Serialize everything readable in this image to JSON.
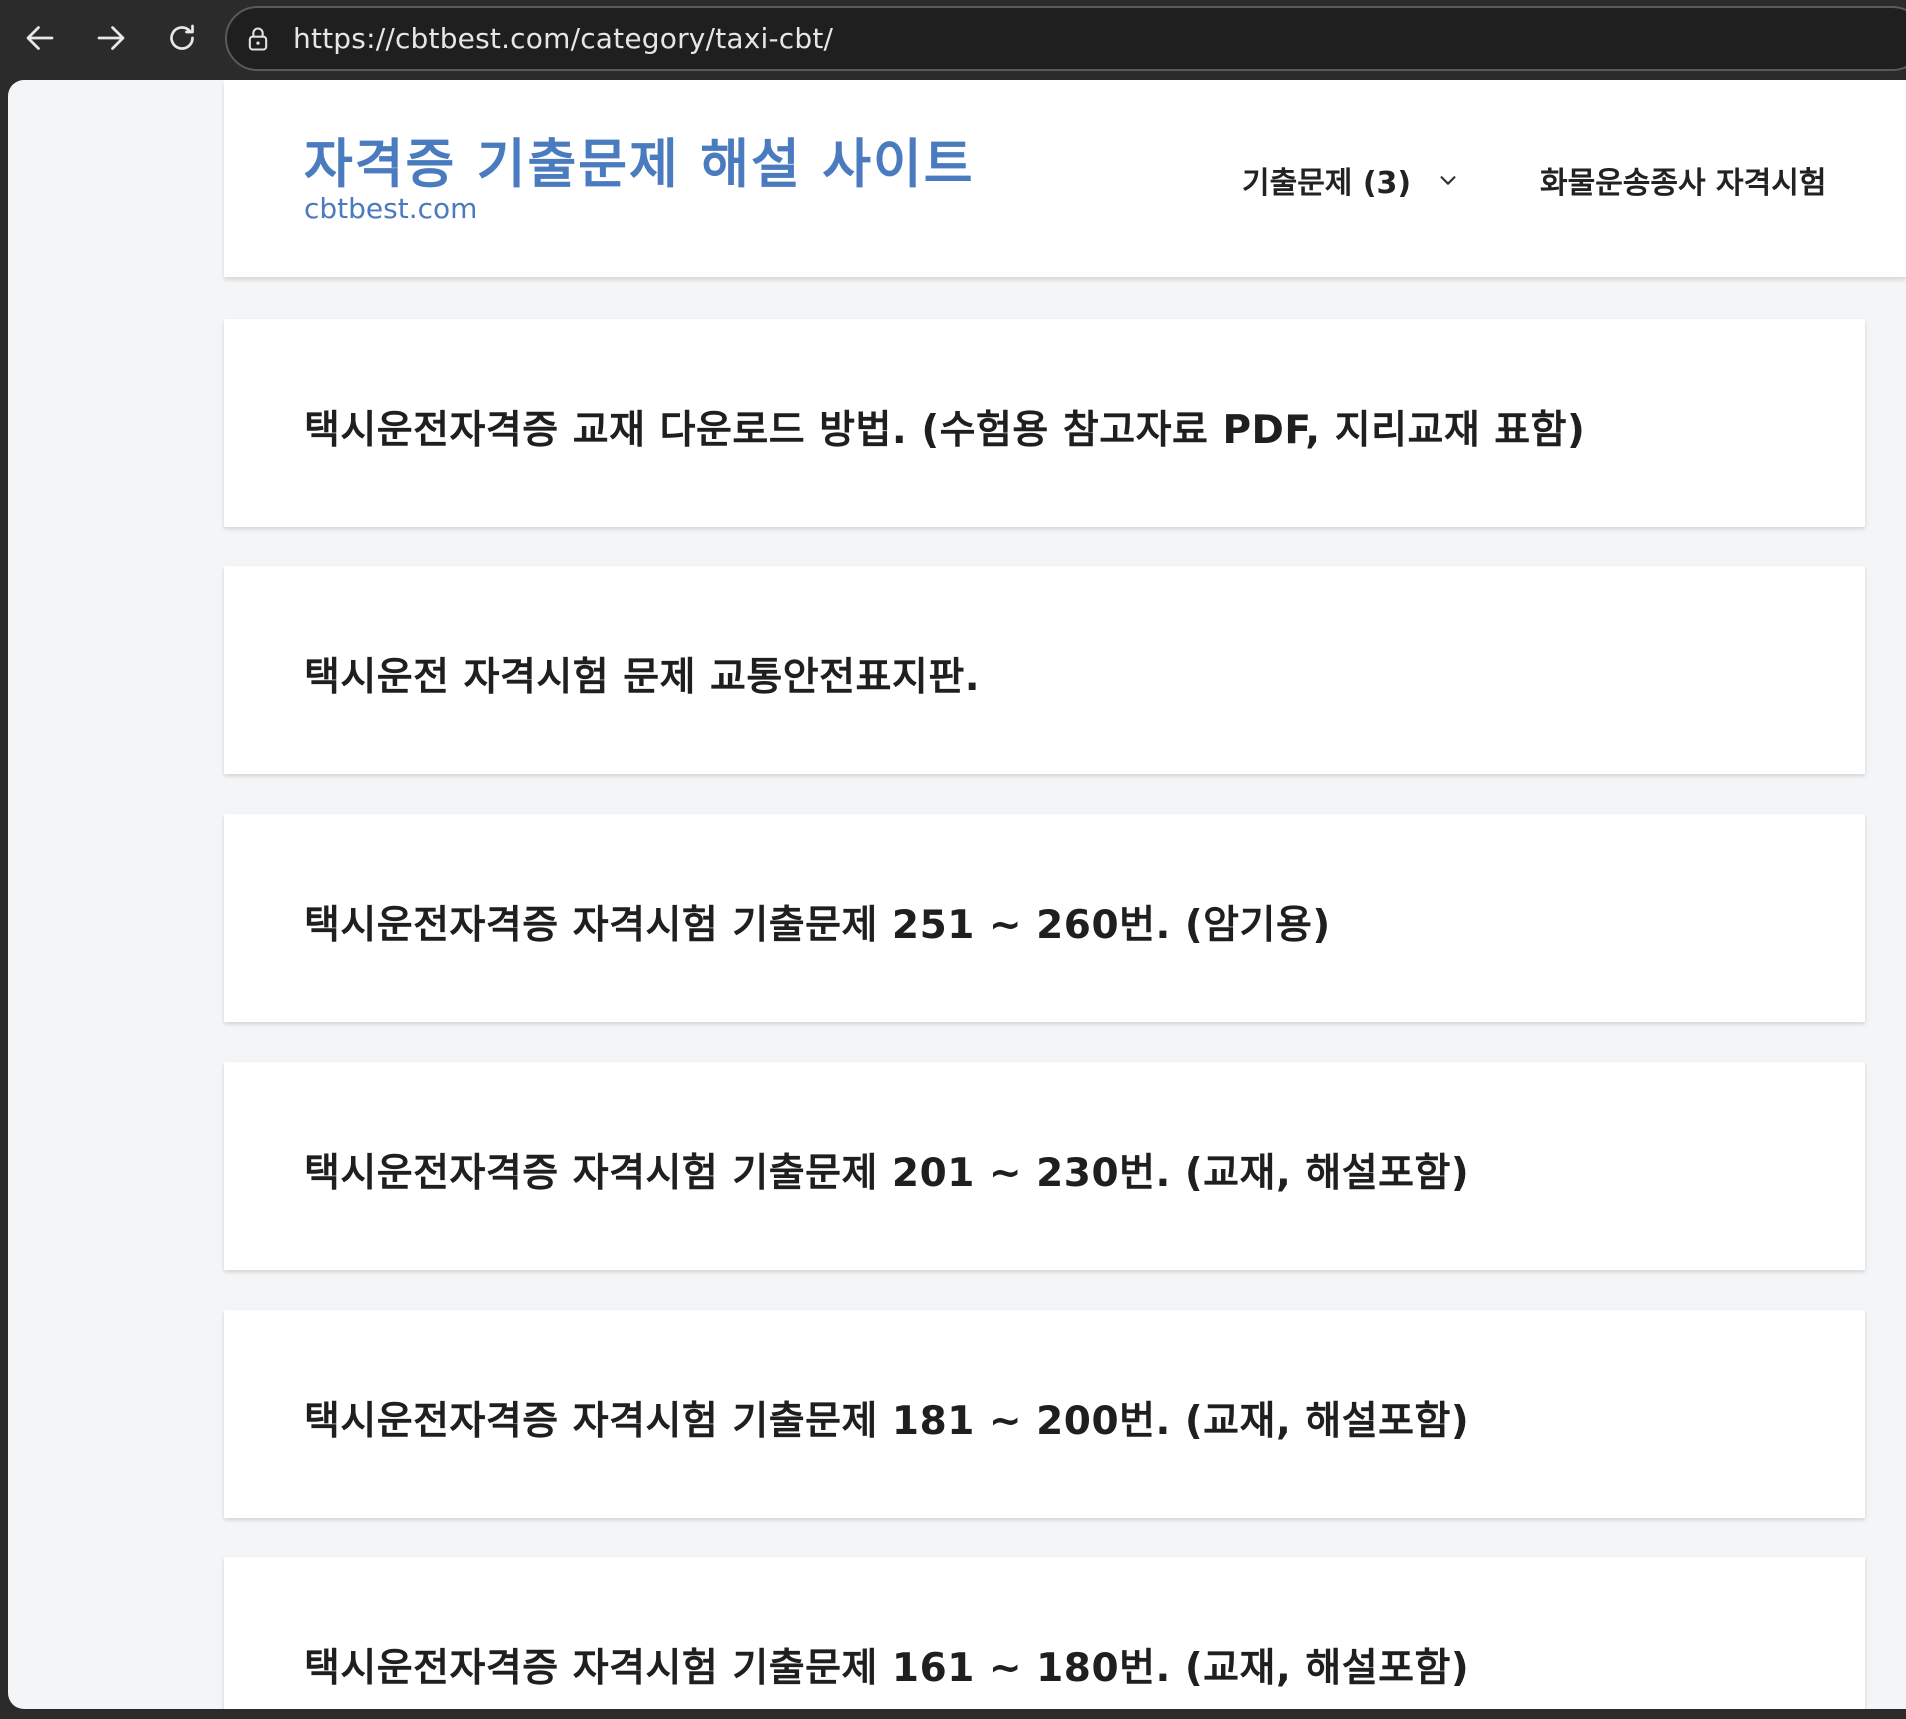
{
  "browser": {
    "url": "https://cbtbest.com/category/taxi-cbt/",
    "back_icon": "arrow-left-icon",
    "forward_icon": "arrow-right-icon",
    "reload_icon": "reload-icon",
    "site_info_icon": "lock-icon"
  },
  "site": {
    "title": "자격증 기출문제 해설 사이트",
    "tagline": "cbtbest.com",
    "brand_color": "#4a7bbf"
  },
  "menu": {
    "items": [
      {
        "label": "기출문제 (3)",
        "has_dropdown": true
      },
      {
        "label": "화물운송종사 자격시험",
        "has_dropdown": false
      }
    ]
  },
  "posts": [
    {
      "title": "택시운전자격증 교재 다운로드 방법. (수험용 참고자료 PDF, 지리교재 표함)"
    },
    {
      "title": "택시운전 자격시험 문제 교통안전표지판."
    },
    {
      "title": "택시운전자격증 자격시험 기출문제 251 ~ 260번. (암기용)"
    },
    {
      "title": "택시운전자격증 자격시험 기출문제 201 ~ 230번. (교재, 해설포함)"
    },
    {
      "title": "택시운전자격증 자격시험 기출문제 181 ~ 200번. (교재, 해설포함)"
    },
    {
      "title": "택시운전자격증 자격시험 기출문제 161 ~ 180번. (교재, 해설포함)"
    }
  ]
}
